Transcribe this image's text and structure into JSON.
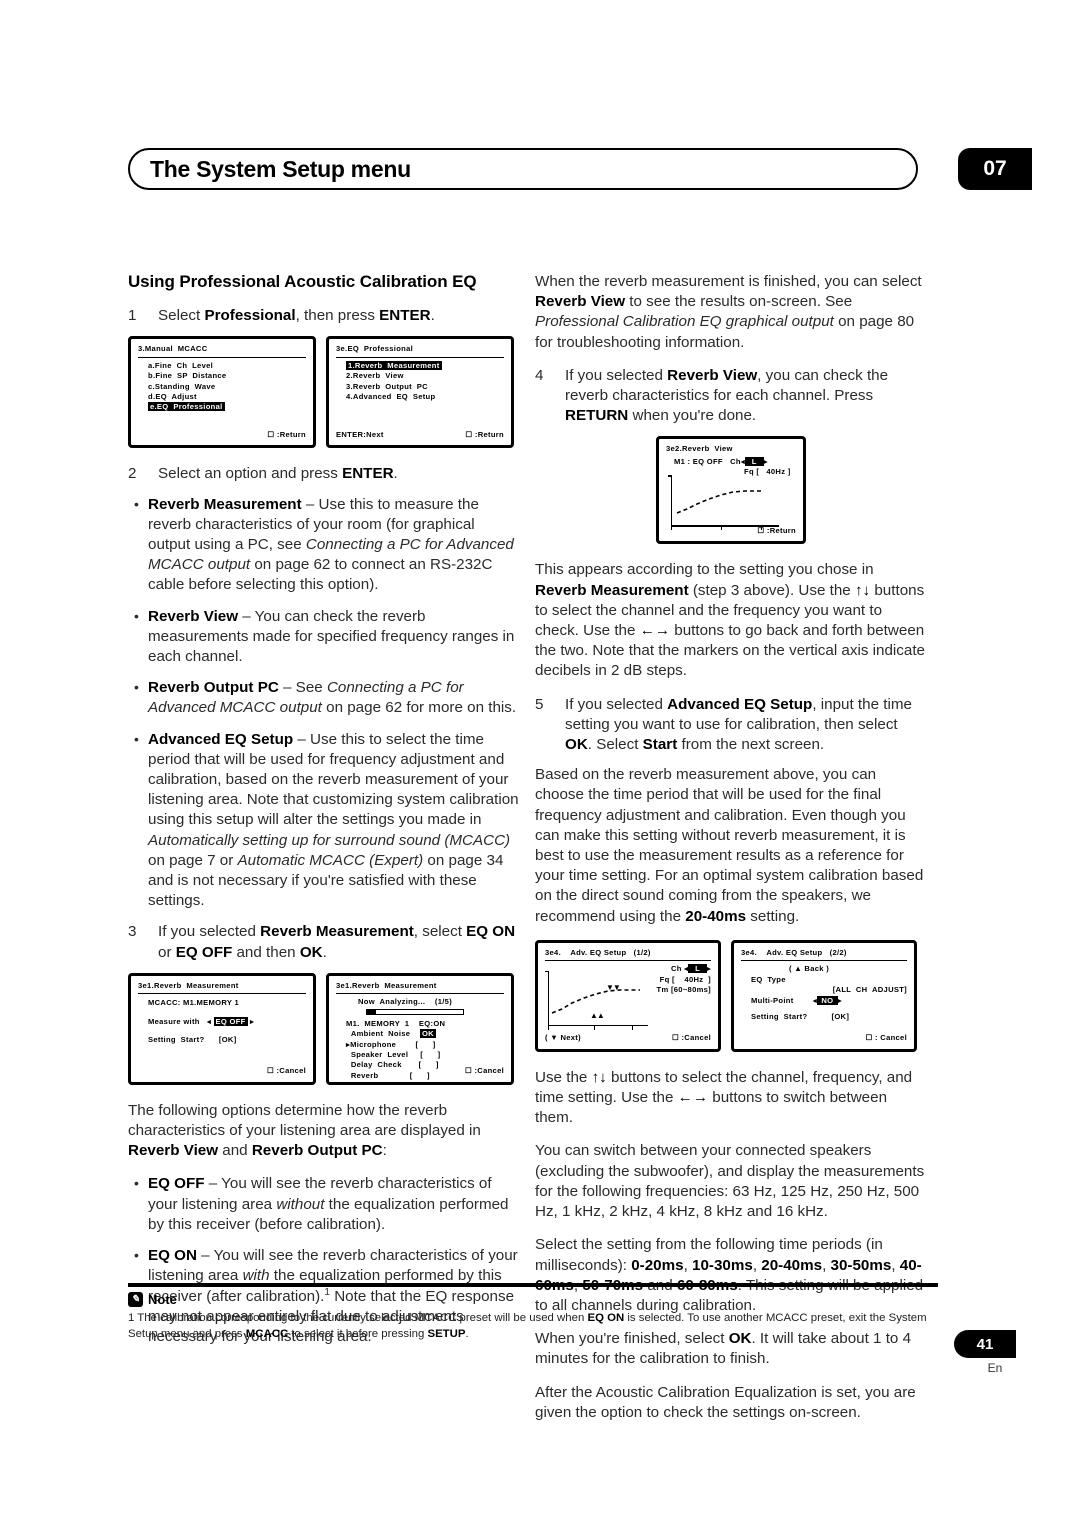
{
  "header": {
    "title": "The System Setup menu",
    "chapter": "07"
  },
  "left": {
    "section_title": "Using Professional Acoustic Calibration EQ",
    "step1": {
      "num": "1",
      "text_a": "Select ",
      "bold_a": "Professional",
      "text_b": ", then press ",
      "bold_b": "ENTER",
      "text_c": "."
    },
    "osd_manual_mcacc": {
      "title": "3.Manual  MCACC",
      "items": [
        "a.Fine  Ch  Level",
        "b.Fine  SP  Distance",
        "c.Standing  Wave",
        "d.EQ  Adjust"
      ],
      "selected": "e.EQ  Professional",
      "footer_right": ":Return"
    },
    "osd_eq_professional": {
      "title": "3e.EQ  Professional",
      "selected": "1.Reverb  Measurement",
      "items": [
        "2.Reverb  View",
        "3.Reverb  Output  PC",
        "4.Advanced  EQ  Setup"
      ],
      "footer_left": "ENTER:Next",
      "footer_right": ":Return"
    },
    "step2": {
      "num": "2",
      "text_a": "Select an option and press ",
      "bold_a": "ENTER",
      "text_b": "."
    },
    "bullets2": [
      {
        "bold": "Reverb Measurement",
        "text": " – Use this to measure the reverb characteristics of your room (for graphical output using a PC, see ",
        "italic": "Connecting a PC for Advanced MCACC output",
        "text2": " on page 62 to connect an RS-232C cable before selecting this option)."
      },
      {
        "bold": "Reverb View",
        "text": " – You can check the reverb measurements made for specified frequency ranges in each channel.",
        "italic": "",
        "text2": ""
      },
      {
        "bold": "Reverb Output PC",
        "text": " – See ",
        "italic": "Connecting a PC for Advanced MCACC output",
        "text2": " on page 62 for more on this."
      },
      {
        "bold": "Advanced EQ Setup",
        "text": " – Use this to select the time period that will be used for frequency adjustment and calibration, based on the reverb measurement of your listening area. Note that customizing system calibration using this setup will alter the settings you made in ",
        "italic": "Automatically setting up for surround sound (MCACC)",
        "text2": " on page 7 or ",
        "italic2": "Automatic MCACC (Expert)",
        "text3": " on page 34 and is not necessary if you're satisfied with these settings."
      }
    ],
    "step3": {
      "num": "3",
      "text_a": "If you selected ",
      "bold_a": "Reverb Measurement",
      "text_b": ", select ",
      "bold_b": "EQ ON",
      "text_c": " or ",
      "bold_c": "EQ OFF",
      "text_d": " and then ",
      "bold_d": "OK",
      "text_e": "."
    },
    "osd_reverb_meas_1": {
      "title": "3e1.Reverb  Measurement",
      "line_preset": "MCACC: M1.MEMORY 1",
      "line_measure_label": "Measure with",
      "measure_value": "EQ OFF",
      "line_start": "Setting  Start?",
      "start_value": "[OK]",
      "footer_right": ":Cancel"
    },
    "osd_reverb_meas_2": {
      "title": "3e1.Reverb  Measurement",
      "analyzing": "Now  Analyzing",
      "analyzing_dots": "...",
      "progress": "(1/5)",
      "memory_line": "M1.  MEMORY  1    EQ:ON",
      "rows": [
        {
          "label": "Ambient  Noise",
          "value": "OK",
          "marker": " ",
          "highlight": true
        },
        {
          "label": "Microphone",
          "value": "[      ]",
          "marker": "▸",
          "highlight": false
        },
        {
          "label": "Speaker  Level",
          "value": "[      ]",
          "marker": " ",
          "highlight": false
        },
        {
          "label": "Delay  Check",
          "value": "[      ]",
          "marker": " ",
          "highlight": false
        },
        {
          "label": "Reverb",
          "value": "[      ]",
          "marker": " ",
          "highlight": false
        }
      ],
      "footer_right": ":Cancel"
    },
    "para_options_intro": {
      "text_a": "The following options determine how the reverb characteristics of your listening area are displayed in ",
      "bold_a": "Reverb View",
      "text_b": " and ",
      "bold_b": "Reverb Output PC",
      "text_c": ":"
    },
    "bullets_eq": [
      {
        "bold": "EQ OFF",
        "text_a": " – You will see the reverb characteristics of your listening area ",
        "italic": "without",
        "text_b": " the equalization performed by this receiver (before calibration).",
        "sup": ""
      },
      {
        "bold": "EQ ON",
        "text_a": " – You will see the reverb characteristics of your listening area ",
        "italic": "with",
        "text_b": " the equalization performed by this receiver (after calibration).",
        "sup": "1",
        "text_c": " Note that the EQ response may not appear entirely flat due to adjustments necessary for your listening area."
      }
    ]
  },
  "right": {
    "para_finished": {
      "text_a": "When the reverb measurement is finished, you can select ",
      "bold_a": "Reverb View",
      "text_b": " to see the results on-screen. See ",
      "italic": "Professional Calibration EQ graphical output",
      "text_c": " on page 80 for troubleshooting information."
    },
    "step4": {
      "num": "4",
      "text_a": "If you selected ",
      "bold_a": "Reverb View",
      "text_b": ", you can check the reverb characteristics for each channel. Press ",
      "bold_b": "RETURN",
      "text_c": " when you're done."
    },
    "osd_reverb_view": {
      "title": "3e2.Reverb  View",
      "line_eq": "M1 : EQ OFF",
      "ch_label": "Ch",
      "ch_value": "L",
      "fq_label": "Fq",
      "fq_value": "[   40Hz ]",
      "footer_right": ":Return"
    },
    "para_appears": {
      "text_a": "This appears according to the setting you chose in ",
      "bold_a": "Reverb Measurement",
      "text_b": " (step 3 above). Use the ",
      "glyph_a": "↑↓",
      "text_c": " buttons to select the channel and the frequency you want to check. Use the ",
      "glyph_b": "←→",
      "text_d": " buttons to go back and forth between the two. Note that the markers on the vertical axis indicate decibels in 2 dB steps."
    },
    "step5": {
      "num": "5",
      "text_a": "If you selected ",
      "bold_a": "Advanced EQ Setup",
      "text_b": ", input the time setting you want to use for calibration, then select ",
      "bold_b": "OK",
      "text_c": ". Select ",
      "bold_c": "Start",
      "text_d": " from the next screen."
    },
    "para_based": {
      "text_a": "Based on the reverb measurement above, you can choose the time period that will be used for the final frequency adjustment and calibration. Even though you can make this setting without reverb measurement, it is best to use the measurement results as a reference for your time setting. For an optimal system calibration based on the direct sound coming from the speakers, we recommend using the ",
      "bold_a": "20-40ms",
      "text_b": " setting."
    },
    "osd_adv_eq_1": {
      "title": "3e4.    Adv. EQ Setup   (1/2)",
      "ch_label": "Ch",
      "ch_value": "L",
      "fq_label": "Fq",
      "fq_value": "[    40Hz  ]",
      "tm_label": "Tm",
      "tm_value": "[60~80ms]",
      "footer_left": "( ▼ Next)",
      "footer_right": ":Cancel"
    },
    "osd_adv_eq_2": {
      "title": "3e4.    Adv. EQ Setup   (2/2)",
      "back": "( ▲ Back )",
      "eq_type_label": "EQ  Type",
      "eq_type_value": "[ALL  CH  ADJUST]",
      "multipoint_label": "Multi-Point",
      "multipoint_value": "NO",
      "start_label": "Setting  Start?",
      "start_value": "[OK]",
      "footer_right": ": Cancel"
    },
    "para_use_buttons": {
      "text_a": "Use the ",
      "glyph_a": "↑↓",
      "text_b": " buttons to select the channel, frequency, and time setting. Use the ",
      "glyph_b": "←→",
      "text_c": " buttons to switch between them."
    },
    "para_switch": "You can switch between your connected speakers (excluding the subwoofer), and display the measurements for the following frequencies: 63 Hz, 125 Hz, 250 Hz, 500 Hz, 1 kHz, 2 kHz, 4 kHz, 8 kHz and 16 kHz.",
    "para_select_setting": {
      "text_a": "Select the setting from the following time periods (in milliseconds): ",
      "v1": "0-20ms",
      "sep1": ", ",
      "v2": "10-30ms",
      "sep2": ", ",
      "v3": "20-40ms",
      "sep3": ", ",
      "v4": "30-50ms",
      "sep4": ", ",
      "v5": "40-60ms",
      "sep5": ", ",
      "v6": "50-70ms",
      "sep6": " and ",
      "v7": "60-80ms",
      "text_b": ". This setting will be applied to all channels during calibration."
    },
    "para_finished2": {
      "text_a": "When you're finished, select ",
      "bold_a": "OK",
      "text_b": ". It will take about 1 to 4 minutes for the calibration to finish."
    },
    "para_after": "After the Acoustic Calibration Equalization is set, you are given the option to check the settings on-screen."
  },
  "note": {
    "heading": "Note",
    "footnote_num": "1",
    "text_a": " The calibration corresponding to the currently selected MCACC preset will be used when ",
    "bold_a": "EQ ON",
    "text_b": " is selected. To use another MCACC preset, exit the System Setup menu and press ",
    "bold_b": "MCACC",
    "text_c": " to select it before pressing ",
    "bold_c": "SETUP",
    "text_d": "."
  },
  "footer": {
    "page": "41",
    "lang": "En"
  }
}
